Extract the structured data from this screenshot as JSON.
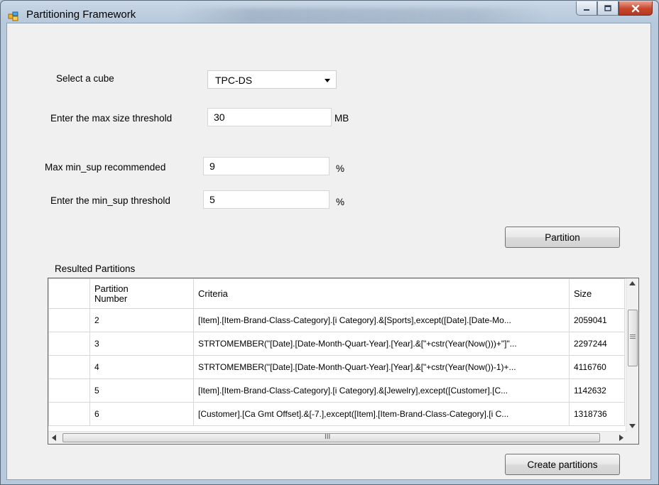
{
  "window": {
    "title": "Partitioning Framework"
  },
  "form": {
    "cube_label": "Select a cube",
    "cube_value": "TPC-DS",
    "max_size_label": "Enter the max size threshold",
    "max_size_value": "30",
    "max_size_unit": "MB",
    "max_minsup_label": "Max min_sup recommended",
    "max_minsup_value": "9",
    "max_minsup_unit": "%",
    "minsup_label": "Enter the min_sup threshold",
    "minsup_value": "5",
    "minsup_unit": "%",
    "partition_button": "Partition",
    "results_label": "Resulted Partitions",
    "create_button": "Create partitions"
  },
  "grid": {
    "columns": [
      "Partition\nNumber",
      "Criteria",
      "Size"
    ],
    "rows": [
      {
        "number": "2",
        "criteria": "[Item].[Item-Brand-Class-Category].[i Category].&[Sports],except([Date].[Date-Mo...",
        "size": "2059041"
      },
      {
        "number": "3",
        "criteria": "STRTOMEMBER(\"[Date].[Date-Month-Quart-Year].[Year].&[\"+cstr(Year(Now()))+\"]\"...",
        "size": "2297244"
      },
      {
        "number": "4",
        "criteria": "STRTOMEMBER(\"[Date].[Date-Month-Quart-Year].[Year].&[\"+cstr(Year(Now())-1)+...",
        "size": "4116760"
      },
      {
        "number": "5",
        "criteria": "[Item].[Item-Brand-Class-Category].[i Category].&[Jewelry],except([Customer].[C...",
        "size": "1142632"
      },
      {
        "number": "6",
        "criteria": "[Customer].[Ca Gmt Offset].&[-7.],except([Item].[Item-Brand-Class-Category].[i C...",
        "size": "1318736"
      }
    ],
    "hscroll_grip": "III"
  },
  "icons": {
    "app": "app-form-icon",
    "minimize": "minimize-icon",
    "maximize": "maximize-icon",
    "close": "close-icon"
  }
}
